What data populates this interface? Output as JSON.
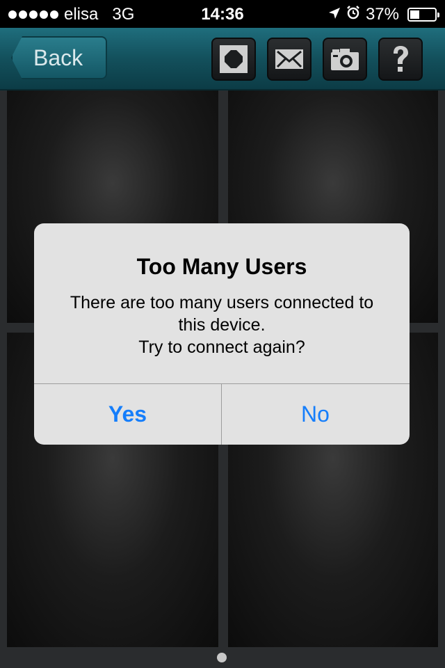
{
  "status_bar": {
    "carrier": "elisa",
    "network": "3G",
    "time": "14:36",
    "battery_percent": "37%",
    "battery_level": 0.37,
    "icons": [
      "signal-dots-icon",
      "location-arrow-icon",
      "alarm-clock-icon",
      "battery-icon"
    ]
  },
  "nav": {
    "back_label": "Back",
    "tools": [
      {
        "name": "fullscreen-icon"
      },
      {
        "name": "mail-icon"
      },
      {
        "name": "camera-icon"
      },
      {
        "name": "help-icon",
        "glyph": "?"
      }
    ]
  },
  "alert": {
    "title": "Too Many Users",
    "message_line1": "There are too many users connected to",
    "message_line2": "this device.",
    "message_line3": "Try to connect again?",
    "yes_label": "Yes",
    "no_label": "No"
  },
  "page_indicator": {
    "pages": 1,
    "current": 1
  },
  "colors": {
    "nav_accent": "#13505c",
    "alert_button": "#157efb"
  }
}
